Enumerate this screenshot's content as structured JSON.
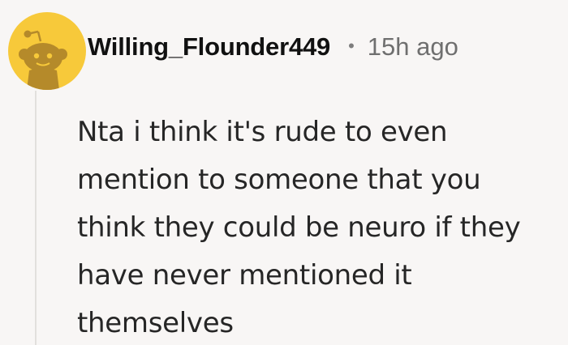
{
  "comment": {
    "author": "Willing_Flounder449",
    "separator": "•",
    "timestamp": "15h ago",
    "body_lines": [
      "Nta i think it's rude to even",
      "mention to someone that you",
      "think they could be neuro if they",
      "have never mentioned it",
      "themselves"
    ]
  },
  "colors": {
    "background": "#f8f6f5",
    "avatar_bg": "#f7c93a",
    "avatar_figure": "#b58a2a",
    "thread_line": "#e2e0dd",
    "username": "#111111",
    "timestamp": "#6f6f6f",
    "body": "#262626"
  },
  "icons": {
    "avatar": "snoo-avatar-icon"
  }
}
